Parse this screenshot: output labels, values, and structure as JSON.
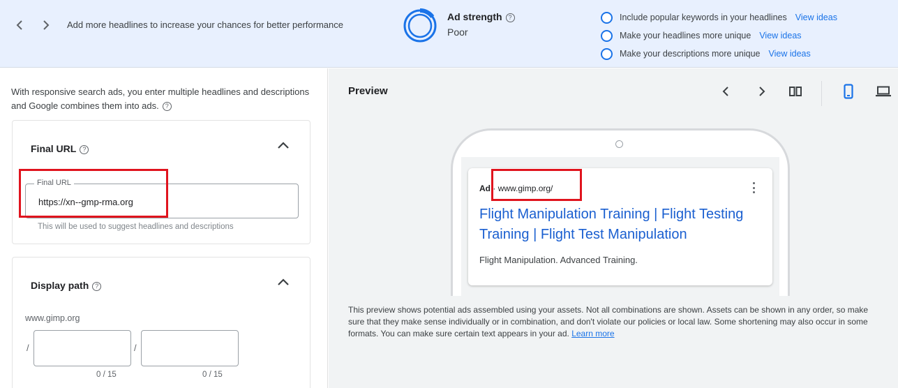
{
  "banner": {
    "hint": "Add more headlines to increase your chances for better performance",
    "strength_label": "Ad strength",
    "strength_value": "Poor",
    "strength_fraction": 0.15,
    "tips": [
      {
        "text": "Include popular keywords in your headlines",
        "link": "View ideas"
      },
      {
        "text": "Make your headlines more unique",
        "link": "View ideas"
      },
      {
        "text": "Make your descriptions more unique",
        "link": "View ideas"
      }
    ]
  },
  "form": {
    "intro": "With responsive search ads, you enter multiple headlines and descriptions and Google combines them into ads.",
    "final_url": {
      "title": "Final URL",
      "field_label": "Final URL",
      "field_value": "https://xn--gmp-rma.org",
      "helper": "This will be used to suggest headlines and descriptions"
    },
    "display_path": {
      "title": "Display path",
      "domain": "www.gimp.org",
      "slash": "/",
      "path1_count": "0 / 15",
      "path2_count": "0 / 15"
    }
  },
  "preview": {
    "title": "Preview",
    "ad_badge": "Ad",
    "ad_separator": "·",
    "ad_url": "www.gimp.org/",
    "ad_headline": "Flight Manipulation Training | Flight Testing Training | Flight Test Manipulation",
    "ad_description": "Flight Manipulation. Advanced Training.",
    "note": "This preview shows potential ads assembled using your assets. Not all combinations are shown. Assets can be shown in any order, so make sure that they make sense individually or in combination, and don't violate our policies or local law. Some shortening may also occur in some formats. You can make sure certain text appears in your ad.",
    "learn_more": "Learn more"
  },
  "colors": {
    "accent": "#1a73e8",
    "banner_bg": "#e8f0fe",
    "highlight": "#e0141e",
    "headline": "#1a5fd0"
  },
  "icons": {
    "help": "?",
    "prev": "‹",
    "next": "›"
  }
}
